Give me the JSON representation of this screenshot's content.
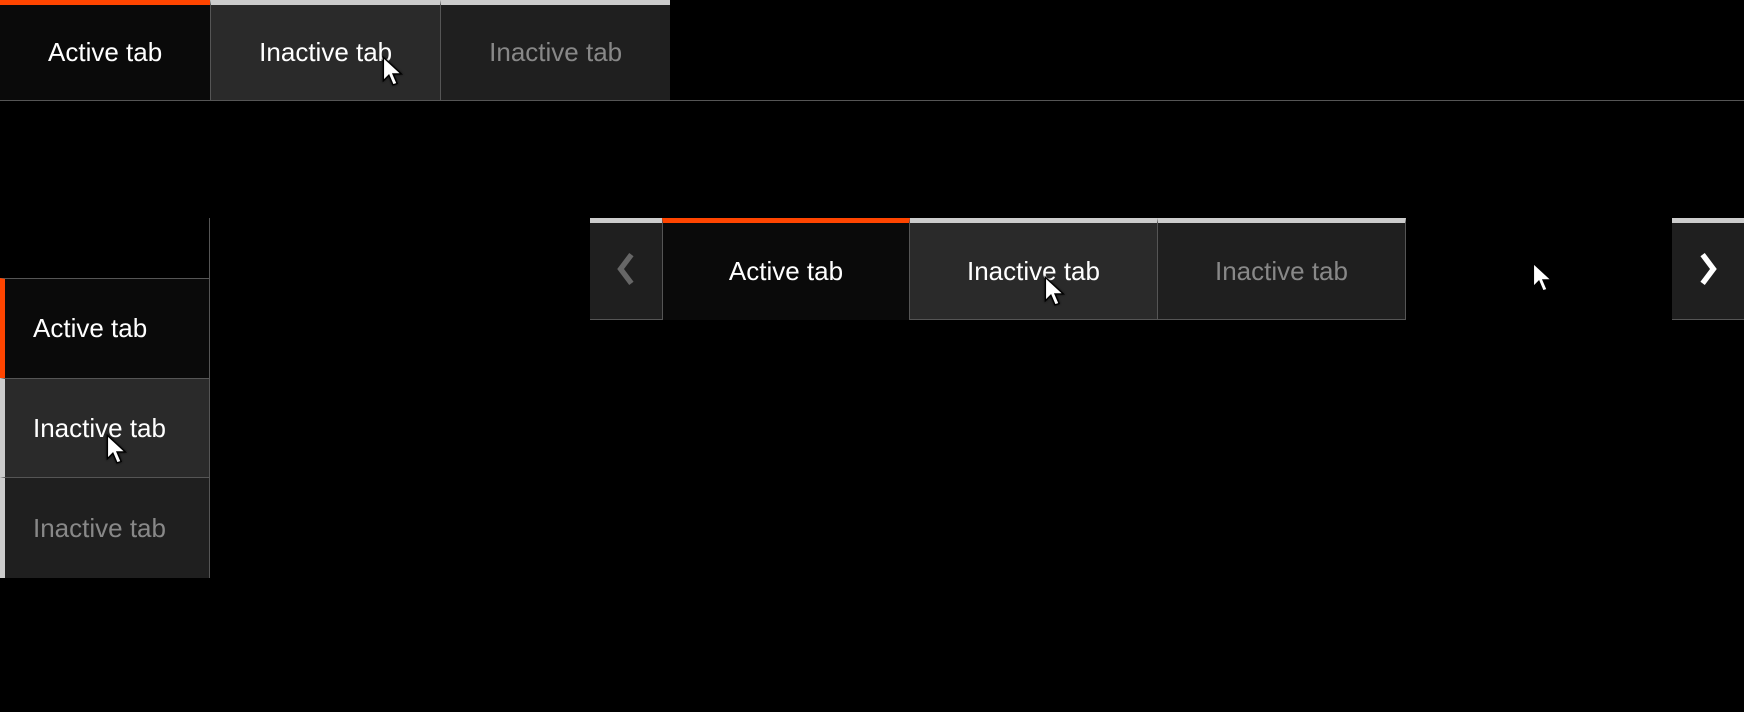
{
  "colors": {
    "accent": "#ff4500",
    "tab_active_bg": "#0a0a0a",
    "tab_hover_bg": "#2a2a2a",
    "tab_inactive_bg": "#1f1f1f",
    "text_active": "#ffffff",
    "text_inactive": "#888888",
    "border": "#555555",
    "top_border": "#cccccc"
  },
  "horizontal_tabs": {
    "items": [
      {
        "label": "Active tab",
        "state": "active"
      },
      {
        "label": "Inactive tab",
        "state": "hover"
      },
      {
        "label": "Inactive tab",
        "state": "inactive"
      }
    ]
  },
  "vertical_tabs": {
    "items": [
      {
        "label": "Active tab",
        "state": "active"
      },
      {
        "label": "Inactive tab",
        "state": "hover"
      },
      {
        "label": "Inactive tab",
        "state": "inactive"
      }
    ]
  },
  "scroll_tabs": {
    "prev_icon": "chevron-left",
    "next_icon": "chevron-right",
    "items": [
      {
        "label": "Active tab",
        "state": "active"
      },
      {
        "label": "Inactive tab",
        "state": "hover"
      },
      {
        "label": "Inactive tab",
        "state": "inactive"
      }
    ]
  }
}
